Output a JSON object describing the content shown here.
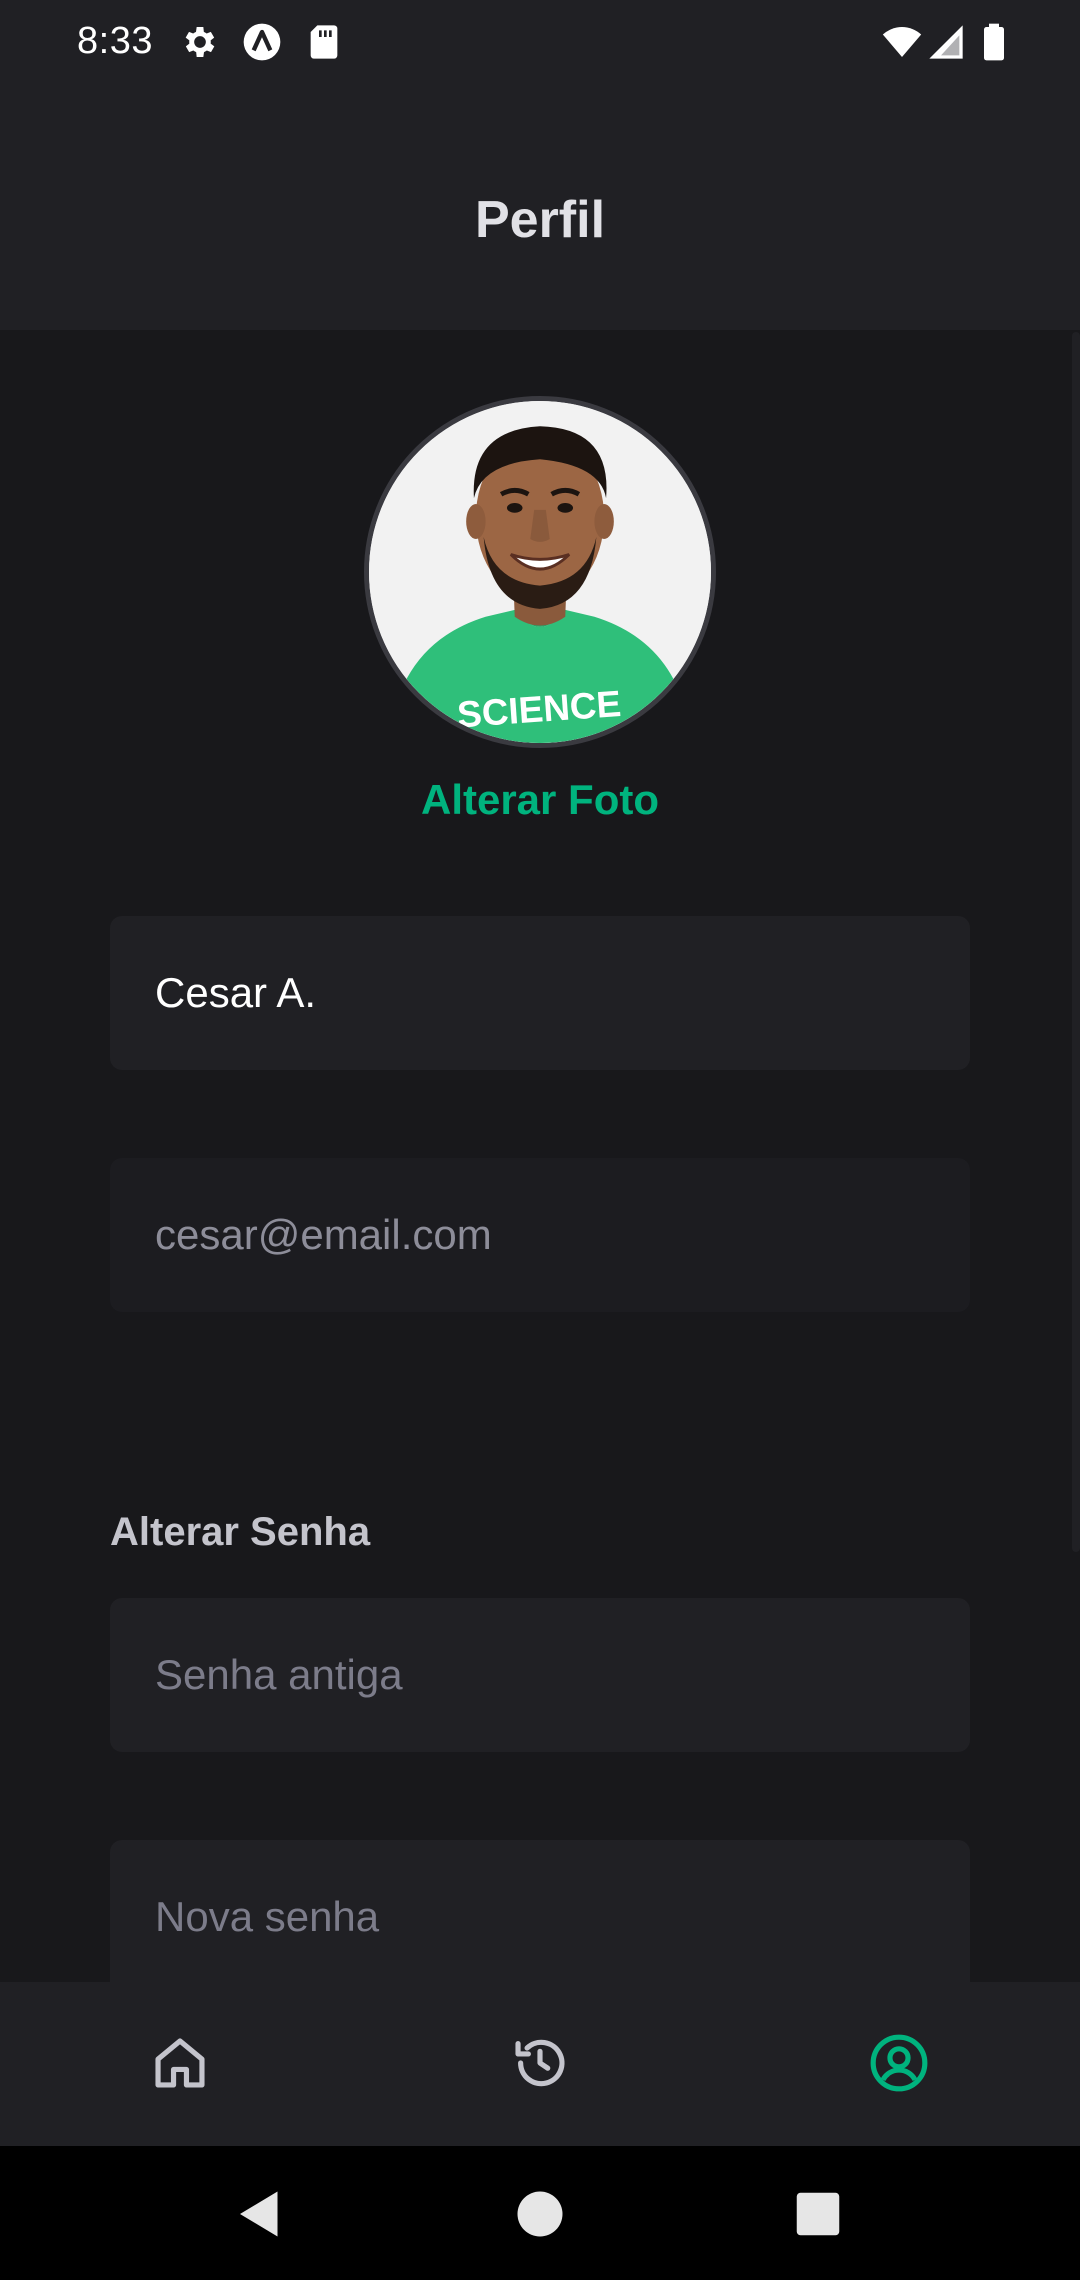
{
  "status_bar": {
    "time": "8:33",
    "icons": [
      "settings-icon",
      "arrow-up-circle-icon",
      "sd-card-icon",
      "wifi-icon",
      "signal-icon",
      "battery-icon"
    ]
  },
  "header": {
    "title": "Perfil"
  },
  "profile": {
    "change_photo_label": "Alterar Foto",
    "name_value": "Cesar A.",
    "email_value": "cesar@email.com"
  },
  "password": {
    "section_title": "Alterar Senha",
    "old_placeholder": "Senha antiga",
    "new_placeholder": "Nova senha"
  },
  "bottom_nav": {
    "items": [
      {
        "icon": "home-icon",
        "active": false
      },
      {
        "icon": "history-icon",
        "active": false
      },
      {
        "icon": "user-circle-icon",
        "active": true
      }
    ]
  },
  "colors": {
    "accent": "#00b37e",
    "background": "#18181b",
    "surface": "#202024",
    "text": "#e1e1e6",
    "placeholder": "#7c7c8a"
  }
}
